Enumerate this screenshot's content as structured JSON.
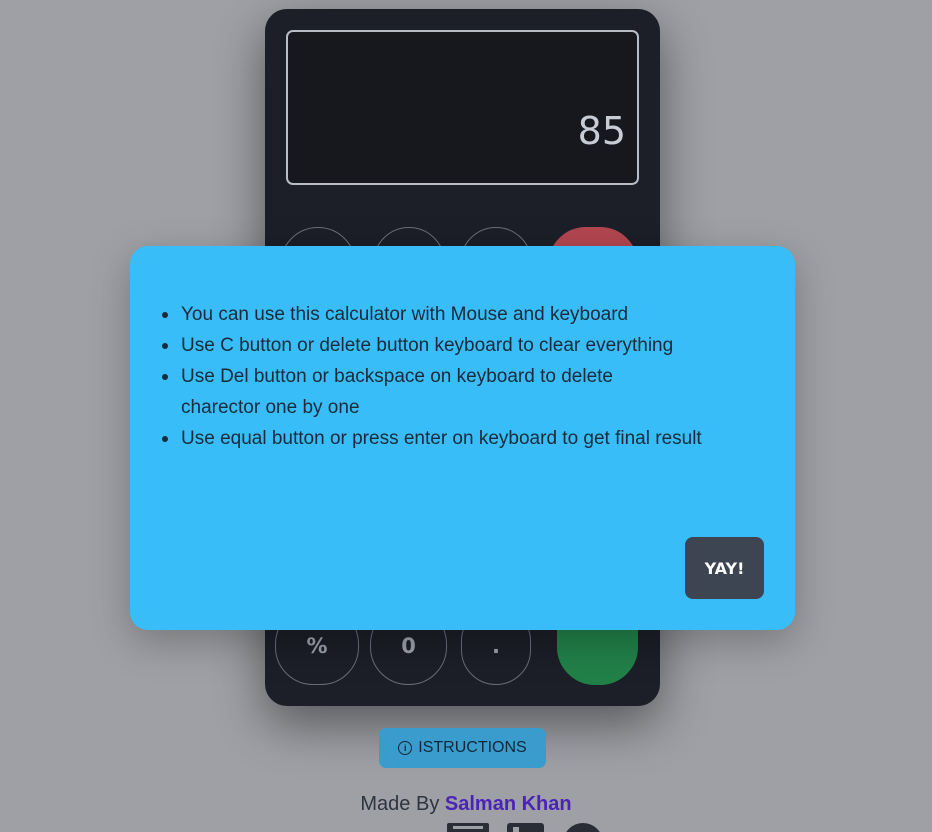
{
  "calculator": {
    "display_value": "85",
    "keys": {
      "percent": "%",
      "zero": "0",
      "decimal": "."
    },
    "colors": {
      "clear": "#b24650",
      "equals": "#218148"
    }
  },
  "modal": {
    "items": [
      "You can use this calculator with Mouse and keyboard",
      "Use C button or delete button keyboard to clear everything",
      "Use Del button or backspace on keyboard to delete charector one by one",
      "Use equal button or press enter on keyboard to get final result"
    ],
    "confirm_label": "YAY!",
    "background": "#38bdf8"
  },
  "instructions_button": {
    "icon": "info-icon",
    "label": "ISTRUCTIONS"
  },
  "footer": {
    "made_by": "Made By",
    "author": "Salman Khan",
    "social_icons": [
      "mail-icon",
      "linkedin-icon",
      "github-icon"
    ]
  }
}
